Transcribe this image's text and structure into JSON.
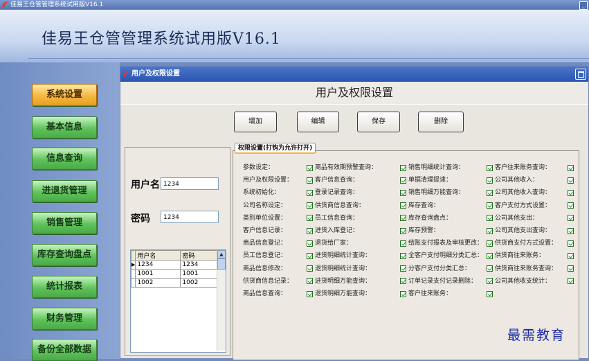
{
  "window": {
    "title": "佳易王仓管管理系统试用版V16.1"
  },
  "banner": {
    "app_title": "佳易王仓管管理系统试用版V16.1"
  },
  "nav": {
    "items": [
      {
        "label": "系统设置",
        "active": true
      },
      {
        "label": "基本信息"
      },
      {
        "label": "信息查询"
      },
      {
        "label": "进退货管理"
      },
      {
        "label": "销售管理"
      },
      {
        "label": "库存查询盘点"
      },
      {
        "label": "统计报表"
      },
      {
        "label": "财务管理"
      },
      {
        "label": "备份全部数据"
      }
    ]
  },
  "subwindow": {
    "title": "用户及权限设置",
    "heading": "用户及权限设置"
  },
  "toolbar": {
    "add": "增加",
    "edit": "编辑",
    "save": "保存",
    "delete": "删除"
  },
  "user_form": {
    "username_label": "用户名",
    "username_value": "1234",
    "password_label": "密码",
    "password_value": "1234"
  },
  "user_table": {
    "headers": [
      "用户名",
      "密码"
    ],
    "rows": [
      {
        "user": "1234",
        "pwd": "1234"
      },
      {
        "user": "1001",
        "pwd": "1001"
      },
      {
        "user": "1002",
        "pwd": "1002"
      }
    ]
  },
  "permissions": {
    "tab_label": "权限设置(打钩为允许打开)",
    "col1": [
      "参数设定：",
      "用户及权限设置：",
      "系统初始化：",
      "公司名称设定：",
      "类别单位设置：",
      "客户信息记录：",
      "商品信息登记：",
      "员工信息登记：",
      "商品信息修改：",
      "供货商信息记录：",
      "商品信息查询："
    ],
    "col2": [
      "商品有效期预警查询：",
      "客户信息查询：",
      "登录记录查询：",
      "供货商信息查询：",
      "员工信息查询：",
      "进货入库登记：",
      "退货给厂家：",
      "进货明细统计查询：",
      "退货明细统计查询：",
      "进货明细万能查询：",
      "退货明细万能查询："
    ],
    "col3": [
      "销售明细统计查询：",
      "单据清理提速：",
      "销售明细万能查询：",
      "库存查询：",
      "库存查询盘点：",
      "库存预警：",
      "结账支付报表及审核更改：",
      "全客户支付明细分类汇总：",
      "分客户支付分类汇总：",
      "订单记录支付记录删除：",
      "客户往来账务："
    ],
    "col4": [
      "客户往来账务查询：",
      "公司其他收入：",
      "公司其他收入查询：",
      "客户支付方式设置：",
      "公司其他支出：",
      "公司其他支出查询：",
      "供货商支付方式设置：",
      "供货商往来账务：",
      "供货商往来账务查询：",
      "公司其他收支统计："
    ]
  },
  "watermark": "最需教育"
}
